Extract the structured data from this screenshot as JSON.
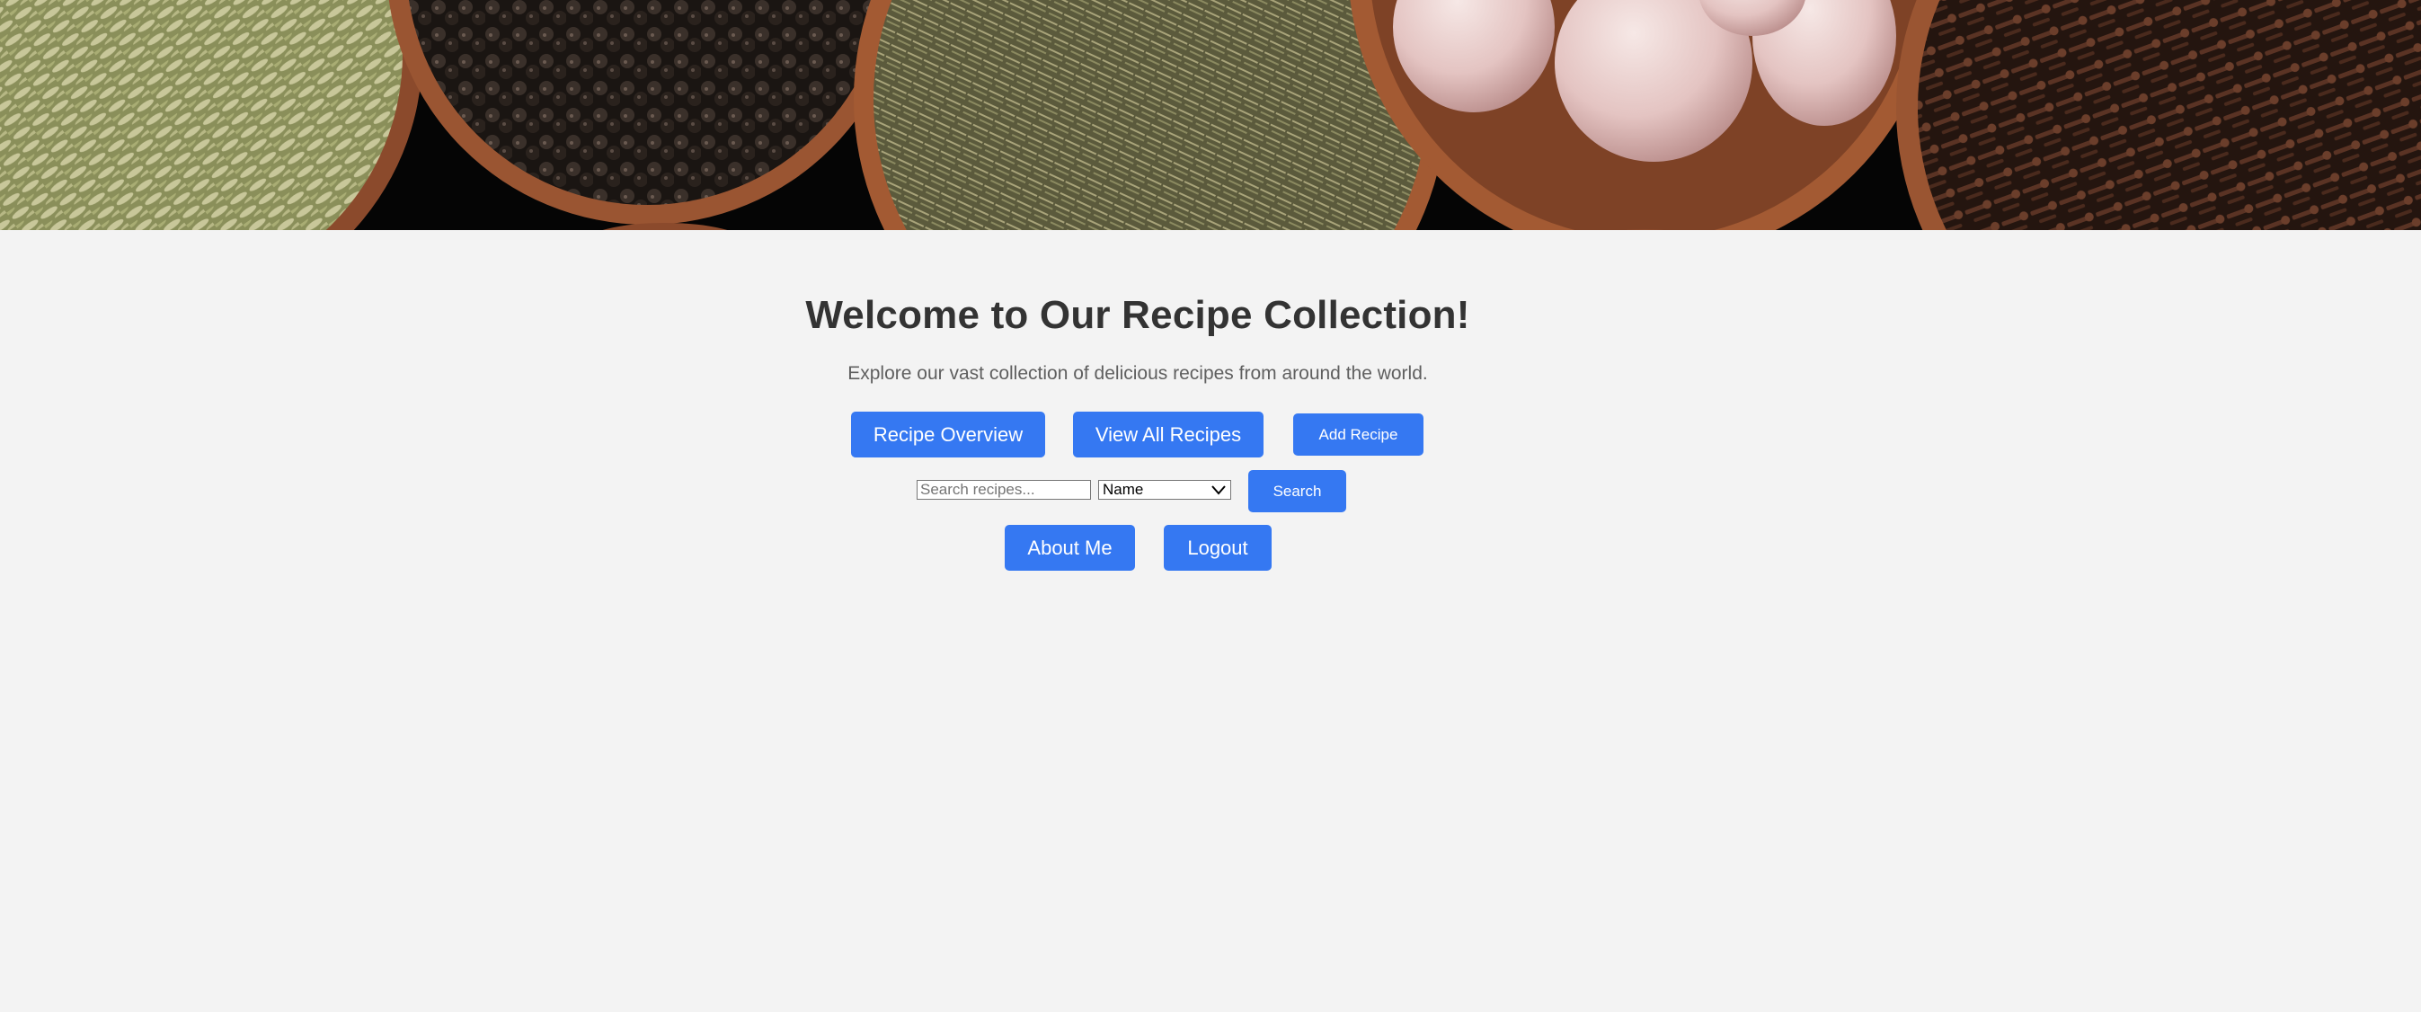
{
  "hero": {
    "image_name": "spice-bowls-banner"
  },
  "main": {
    "title": "Welcome to Our Recipe Collection!",
    "subtitle": "Explore our vast collection of delicious recipes from around the world."
  },
  "nav": {
    "recipe_overview": "Recipe Overview",
    "view_all_recipes": "View All Recipes",
    "add_recipe": "Add Recipe"
  },
  "search": {
    "placeholder": "Search recipes...",
    "value": "",
    "filter_selected": "Name",
    "button_label": "Search"
  },
  "account": {
    "about_me": "About Me",
    "logout": "Logout"
  },
  "colors": {
    "background": "#f3f3f3",
    "accent": "#3578f2",
    "title": "#333333",
    "subtitle": "#5f5f5f"
  },
  "icons": {
    "select_arrow": "chevron-down-icon"
  }
}
